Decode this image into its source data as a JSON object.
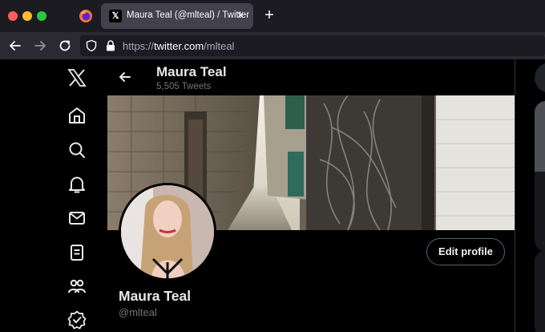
{
  "browser": {
    "tab": {
      "title": "Maura Teal (@mlteal) / Twitter",
      "favicon": "𝕏",
      "close": "×"
    },
    "new_tab": "+",
    "url": {
      "scheme": "https://",
      "host": "twitter.com",
      "path": "/mlteal"
    }
  },
  "header": {
    "name": "Maura Teal",
    "tweet_count": "5,505 Tweets"
  },
  "profile": {
    "display_name": "Maura Teal",
    "handle": "@mlteal",
    "edit_button": "Edit profile"
  },
  "nav": {
    "items": [
      "x-logo-icon",
      "home-icon",
      "search-icon",
      "bell-icon",
      "mail-icon",
      "lists-icon",
      "communities-icon",
      "verified-icon"
    ]
  },
  "colors": {
    "background": "#000000",
    "text": "#e7e9ea",
    "muted": "#71767b",
    "border": "#2f3336"
  }
}
